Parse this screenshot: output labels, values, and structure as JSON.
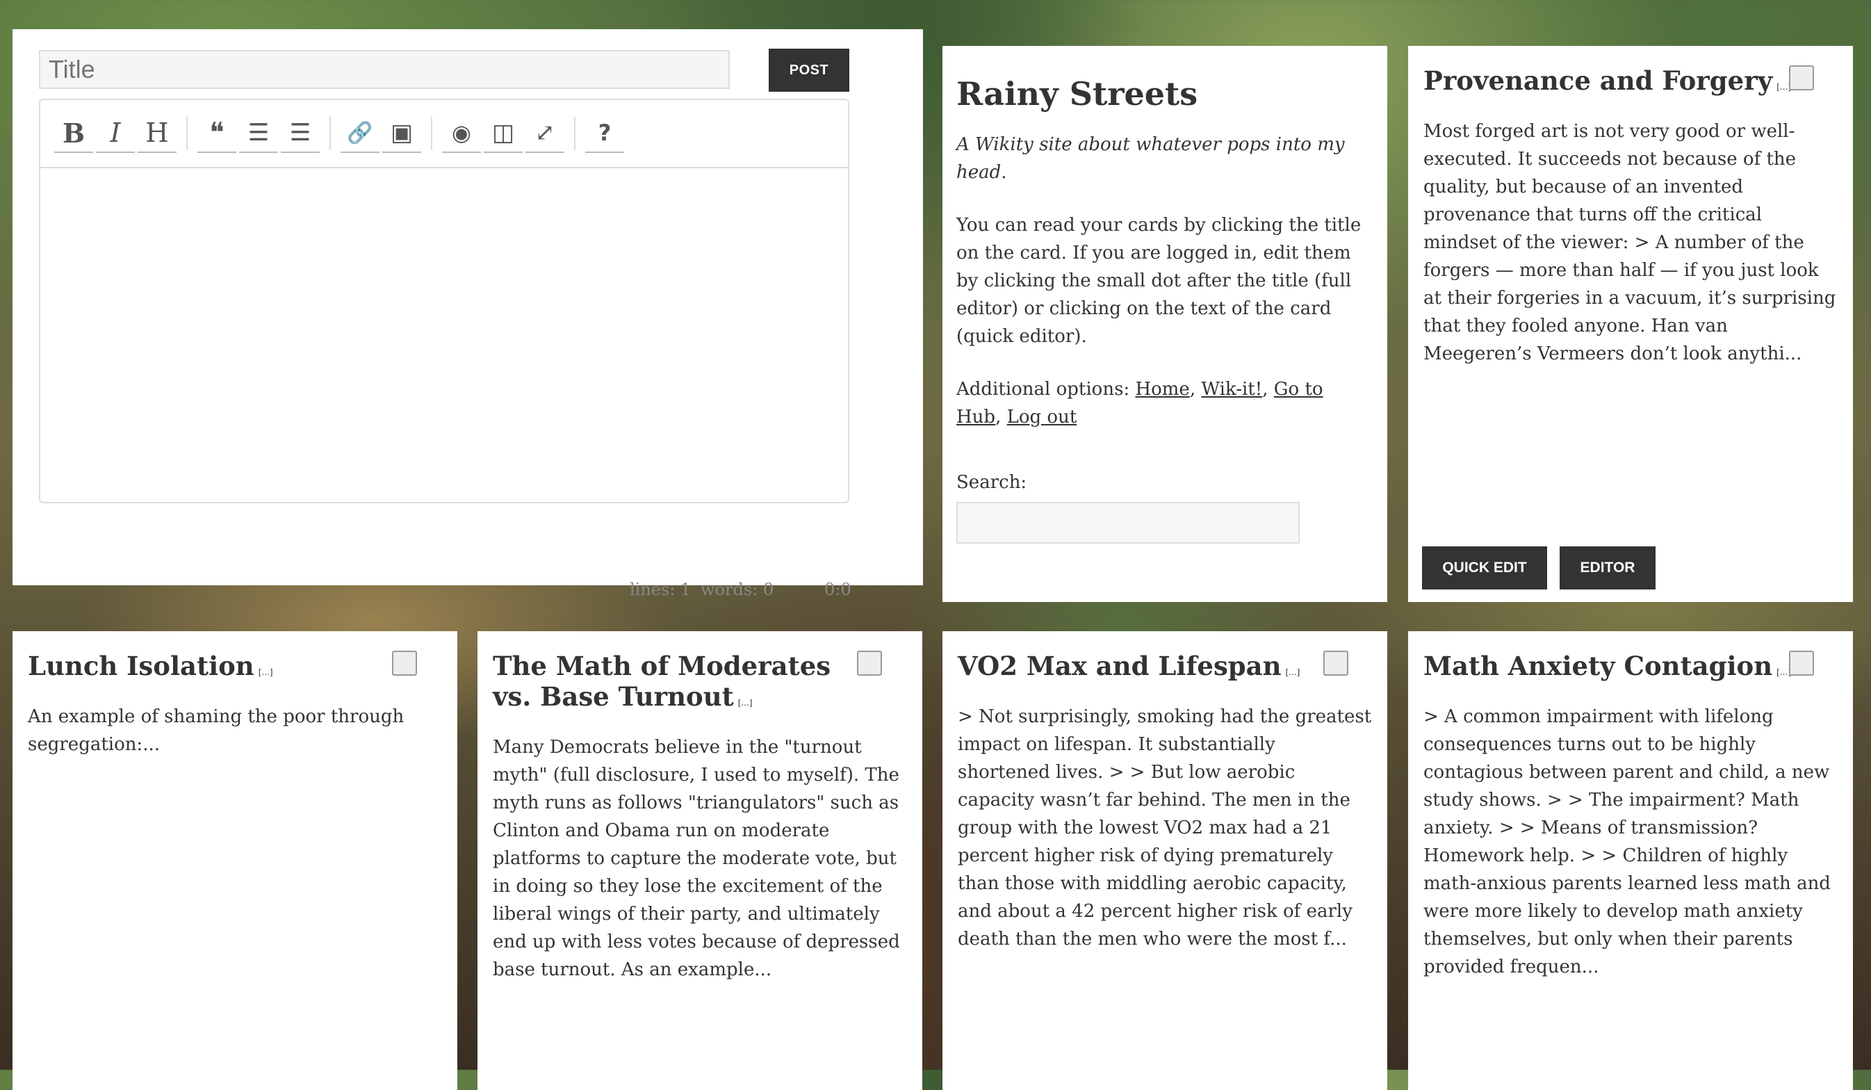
{
  "editor": {
    "title_placeholder": "Title",
    "post_label": "POST",
    "toolbar": {
      "bold": "B",
      "italic": "I",
      "heading": "H",
      "quote": "❝",
      "ul": "☰",
      "ol": "☰",
      "link": "🔗",
      "image": "▣",
      "preview": "◉",
      "side": "◫",
      "fullscreen": "⤢",
      "help": "?"
    },
    "status": {
      "lines": "lines: 1",
      "words": "words: 0",
      "cursor": "0:0"
    }
  },
  "intro": {
    "site_title": "Rainy Streets",
    "tagline": "A Wikity site about whatever pops into my head.",
    "description": "You can read your cards by clicking the title on the card. If you are logged in, edit them by clicking the small dot after the title (full editor) or clicking on the text of the card (quick editor).",
    "options_prefix": "Additional options: ",
    "links": {
      "home": "Home",
      "wikit": "Wik-it!",
      "hub": "Go to Hub",
      "logout": "Log out"
    },
    "search_label": "Search:"
  },
  "cards": [
    {
      "title": "Provenance and Forgery",
      "more": "[...]",
      "body": "Most forged art is not very good or well-executed. It succeeds not because of the quality, but because of an invented provenance that turns off the critical mindset of the viewer: > A number of the forgers — more than half — if you just look at their forgeries in a vacuum, it’s surprising that they fooled anyone. Han van Meegeren’s Vermeers don’t look anythi...",
      "quick_edit": "QUICK EDIT",
      "editor": "EDITOR"
    },
    {
      "title": "Lunch Isolation",
      "more": "[...]",
      "body": "An example of shaming the poor through segregation:..."
    },
    {
      "title": "The Math of Moderates vs. Base Turnout",
      "more": "[...]",
      "body": "Many Democrats believe in the \"turnout myth\" (full disclosure, I used to myself). The myth runs as follows \"triangulators\" such as Clinton and Obama run on moderate platforms to capture the moderate vote, but in doing so they lose the excitement of the liberal wings of their party, and ultimately end up with less votes because of depressed base turnout. As an example..."
    },
    {
      "title": "VO2 Max and Lifespan",
      "more": "[...]",
      "body": "> Not surprisingly, smoking had the greatest impact on lifespan. It substantially shortened lives. > > But low aerobic capacity wasn’t far behind. The men in the group with the lowest VO2 max had a 21 percent higher risk of dying prematurely than those with middling aerobic capacity, and about a 42 percent higher risk of early death than the men who were the most f..."
    },
    {
      "title": "Math Anxiety Contagion",
      "more": "[...]",
      "body": "> A common impairment with lifelong consequences turns out to be highly contagious between parent and child, a new study shows. > > The impairment? Math anxiety. > > Means of transmission? Homework help. > > Children of highly math-anxious parents learned less math and were more likely to develop math anxiety themselves, but only when their parents provided frequen..."
    }
  ]
}
